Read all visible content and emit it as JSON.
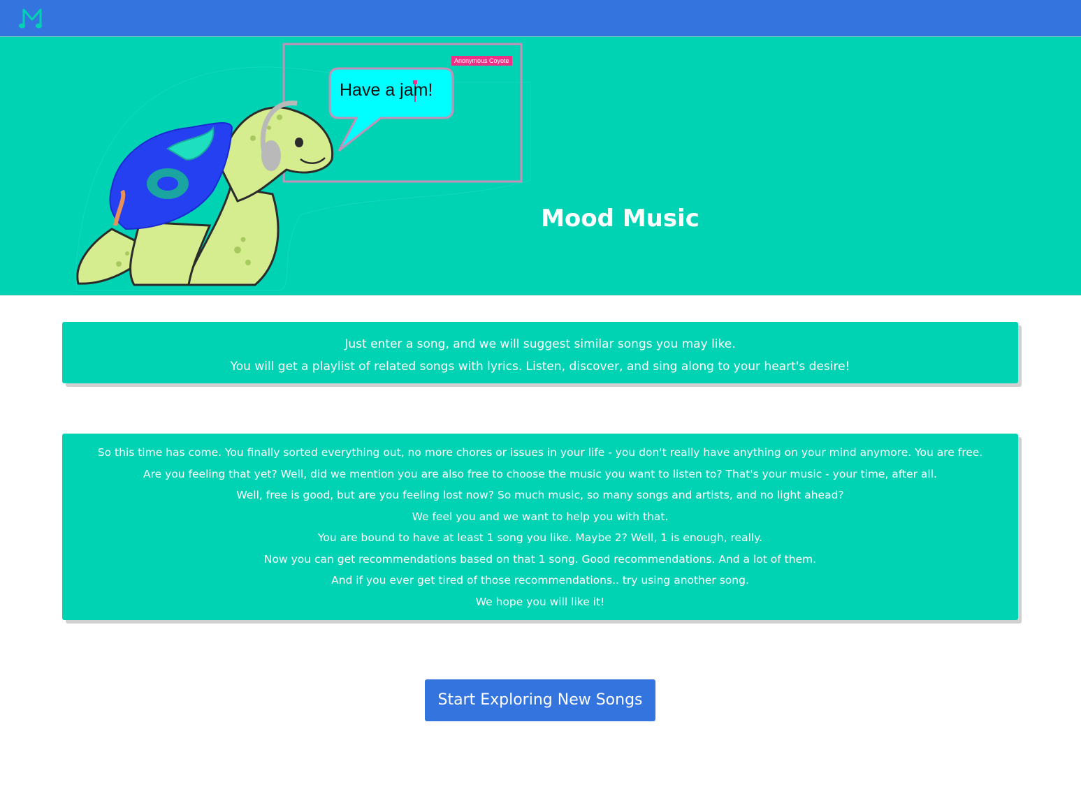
{
  "navbar": {
    "logo_icon": "music-note-m-logo"
  },
  "hero": {
    "title": "Mood Music",
    "speech_bubble": "Have a jam!",
    "username_tag": "Anonymous Coyote",
    "mascot": "turtle-with-headphones-and-music-shell"
  },
  "intro": {
    "lines": [
      "Just enter a song, and we will suggest similar songs you may like.",
      "You will get a playlist of related songs with lyrics. Listen, discover, and sing along to your heart's desire!"
    ]
  },
  "story": {
    "lines": [
      "So this time has come. You finally sorted everything out, no more chores or issues in your life - you don't really have anything on your mind anymore. You are free.",
      "Are you feeling that yet? Well, did we mention you are also free to choose the music you want to listen to? That's your music - your time, after all.",
      "Well, free is good, but are you feeling lost now? So much music, so many songs and artists, and no light ahead?",
      "We feel you and we want to help you with that.",
      "You are bound to have at least 1 song you like. Maybe 2? Well, 1 is enough, really.",
      "Now you can get recommendations based on that 1 song. Good recommendations. And a lot of them.",
      "And if you ever get tired of those recommendations.. try using another song.",
      "We hope you will like it!"
    ]
  },
  "cta": {
    "label": "Start Exploring New Songs"
  },
  "colors": {
    "nav_blue": "#3474de",
    "teal": "#00d3b4",
    "accent_pink": "#ee2f86"
  }
}
